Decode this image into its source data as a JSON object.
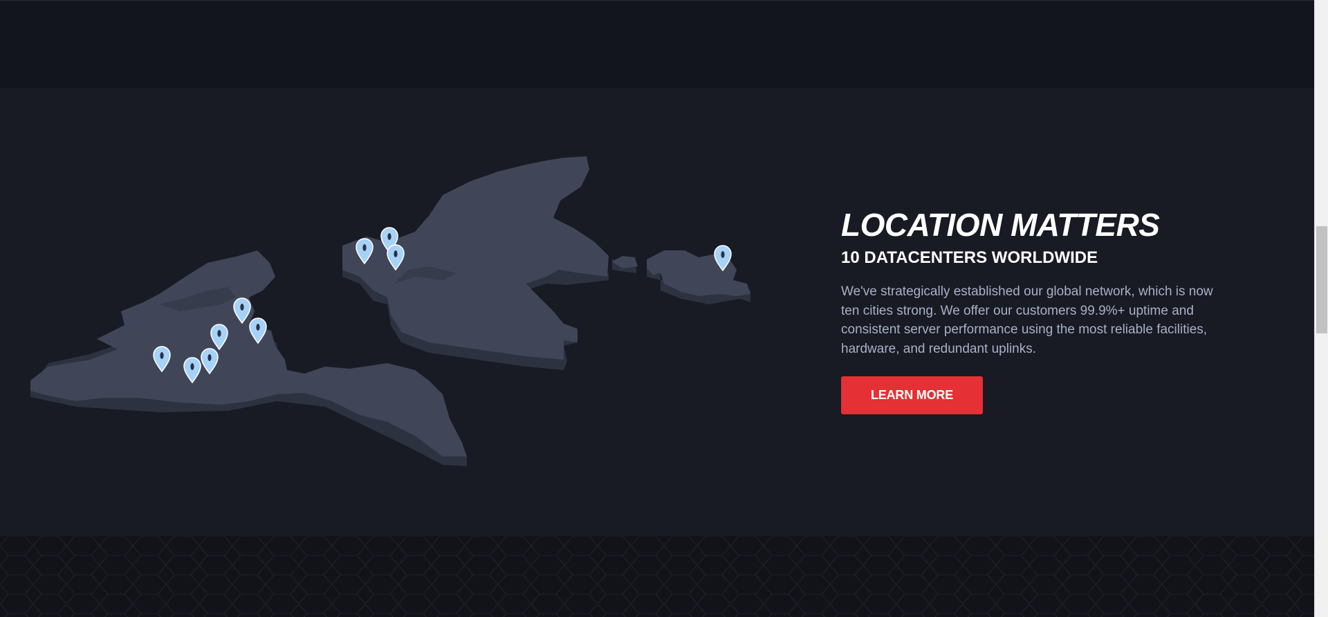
{
  "section": {
    "title": "LOCATION MATTERS",
    "subtitle": "10 DATACENTERS WORLDWIDE",
    "description": "We've strategically established our global network, which is now ten cities strong. We offer our customers 99.9%+ uptime and consistent server performance using the most reliable facilities, hardware, and redundant uplinks.",
    "button_label": "LEARN MORE"
  },
  "map": {
    "pin_icon": "map-pin-icon",
    "pin_count": 10
  },
  "colors": {
    "background": "#181a24",
    "accent": "#e53035",
    "land": "#404657",
    "land_side": "#2d3240",
    "pin": "#a7d2f7"
  }
}
